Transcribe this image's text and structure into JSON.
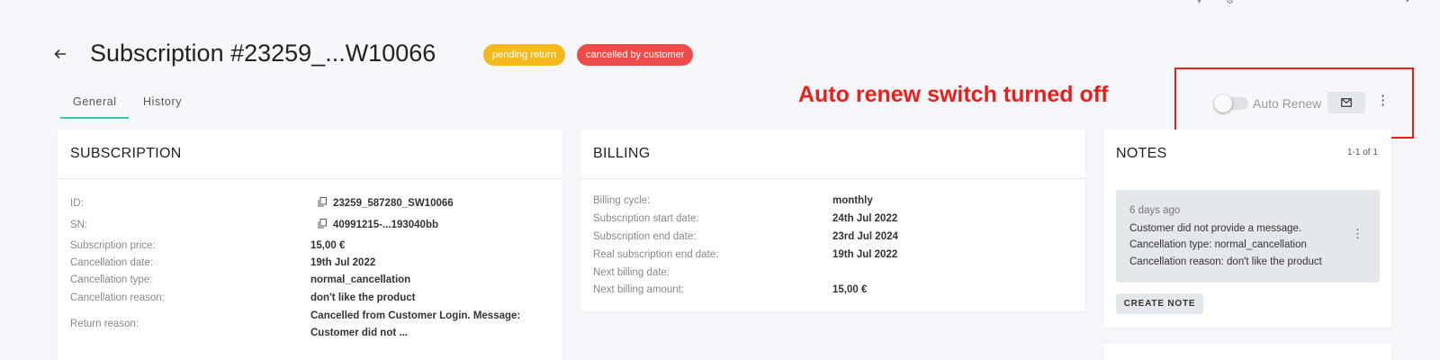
{
  "header": {
    "back_icon": "arrow-left-icon",
    "title": "Subscription #23259_...W10066",
    "badges": [
      {
        "label": "pending return",
        "color": "#f6b81f"
      },
      {
        "label": "cancelled by customer",
        "color": "#ee4b4b"
      }
    ]
  },
  "tabs": [
    {
      "label": "General",
      "active": true
    },
    {
      "label": "History",
      "active": false
    }
  ],
  "annotation": {
    "text": "Auto renew switch turned off",
    "color": "#e8201b"
  },
  "actions": {
    "auto_renew_label": "Auto Renew",
    "auto_renew_on": false,
    "mail_icon": "mail-icon",
    "more_icon": "more-vertical-icon"
  },
  "subscription": {
    "title": "SUBSCRIPTION",
    "rows": [
      {
        "label": "ID:",
        "value": "23259_587280_SW10066",
        "copy": true
      },
      {
        "label": "SN:",
        "value": "40991215-...193040bb",
        "copy": true
      },
      {
        "label": "Subscription price:",
        "value": "15,00 €"
      },
      {
        "label": "Cancellation date:",
        "value": "19th Jul 2022"
      },
      {
        "label": "Cancellation type:",
        "value": "normal_cancellation"
      },
      {
        "label": "Cancellation reason:",
        "value": "don't like the product"
      },
      {
        "label": "Return reason:",
        "value": "Cancelled from Customer Login. Message:",
        "value2": "Customer did not ..."
      }
    ]
  },
  "billing": {
    "title": "BILLING",
    "rows": [
      {
        "label": "Billing cycle:",
        "value": "monthly"
      },
      {
        "label": "Subscription start date:",
        "value": "24th Jul 2022"
      },
      {
        "label": "Subscription end date:",
        "value": "23rd Jul 2024"
      },
      {
        "label": "Real subscription end date:",
        "value": "19th Jul 2022"
      },
      {
        "label": "Next billing date:",
        "value": ""
      },
      {
        "label": "Next billing amount:",
        "value": "15,00 €"
      }
    ]
  },
  "notes": {
    "title": "NOTES",
    "count": "1-1 of 1",
    "items": [
      {
        "time": "6 days ago",
        "lines": [
          "Customer did not provide a message.",
          "Cancellation type: normal_cancellation",
          "Cancellation reason: don't like the product"
        ]
      }
    ],
    "create_label": "CREATE NOTE"
  }
}
